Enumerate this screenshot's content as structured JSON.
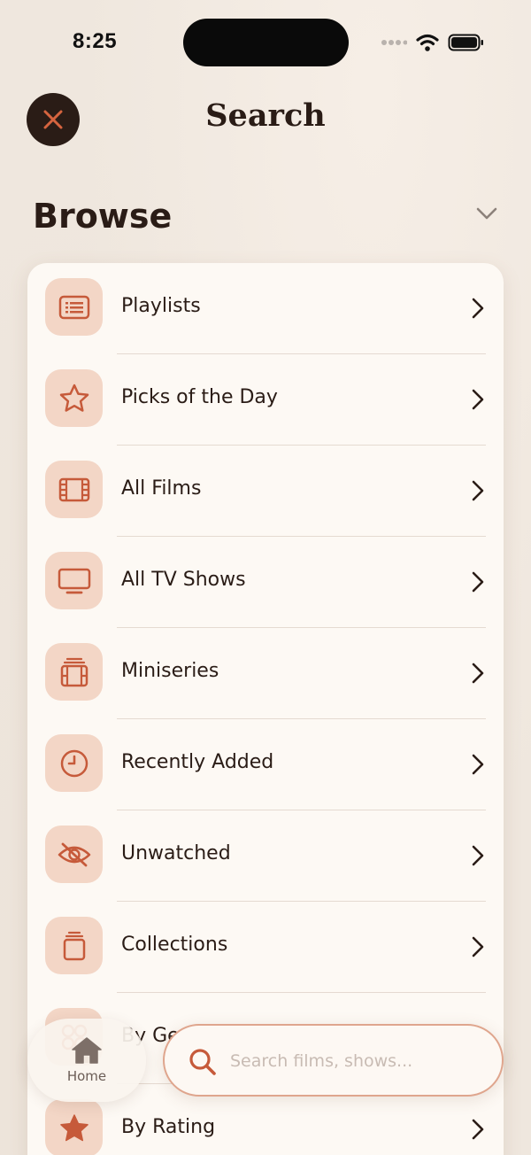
{
  "status_bar": {
    "time": "8:25"
  },
  "header": {
    "title": "Search"
  },
  "browse": {
    "title": "Browse",
    "items": [
      {
        "label": "Playlists",
        "icon": "playlist-icon"
      },
      {
        "label": "Picks of the Day",
        "icon": "star-outline-icon"
      },
      {
        "label": "All Films",
        "icon": "film-icon"
      },
      {
        "label": "All TV Shows",
        "icon": "tv-icon"
      },
      {
        "label": "Miniseries",
        "icon": "miniseries-icon"
      },
      {
        "label": "Recently Added",
        "icon": "clock-icon"
      },
      {
        "label": "Unwatched",
        "icon": "eye-slash-icon"
      },
      {
        "label": "Collections",
        "icon": "collections-icon"
      },
      {
        "label": "By Genre",
        "icon": "genre-icon"
      },
      {
        "label": "By Rating",
        "icon": "star-filled-icon"
      }
    ]
  },
  "tab_bar": {
    "home_label": "Home"
  },
  "search": {
    "placeholder": "Search films, shows..."
  },
  "colors": {
    "accent": "#c65a3a",
    "icon_tile": "#f3d6c6",
    "background": "#efe7de",
    "card": "#fdf9f4",
    "dark": "#2a1c16"
  }
}
